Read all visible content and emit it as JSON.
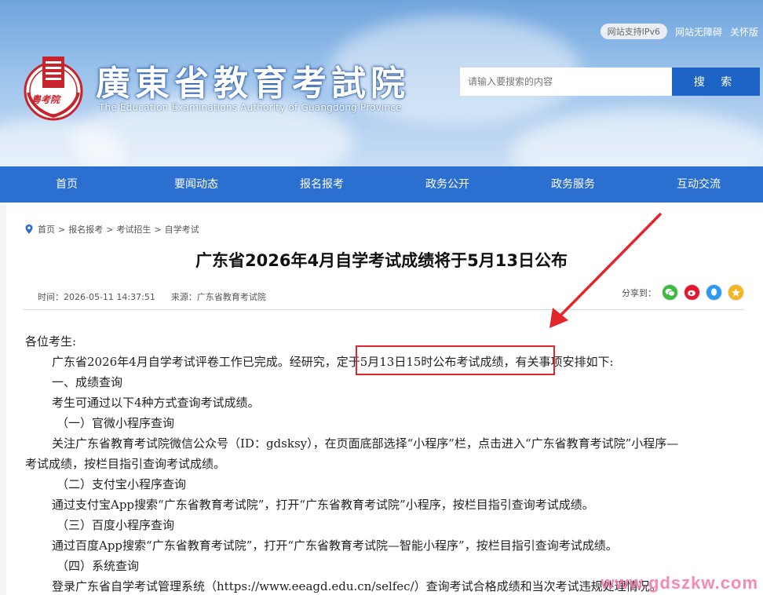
{
  "header": {
    "ipv6_badge": "网站支持IPv6",
    "accessibility_link": "网站无障碍",
    "care_link": "关怀版",
    "logo_title": "廣東省教育考試院",
    "logo_subtitle": "The Education Examinations Authority of Guangdong Province",
    "emblem_text": "粤考院",
    "search_placeholder": "请输入要搜索的内容",
    "search_button": "搜 索"
  },
  "nav": {
    "items": [
      "首页",
      "要闻动态",
      "报名报考",
      "政务公开",
      "政务服务",
      "互动交流"
    ]
  },
  "breadcrumb": {
    "items": [
      "首页",
      "报名报考",
      "考试招生",
      "自学考试"
    ],
    "separator": ">"
  },
  "article": {
    "title": "广东省2026年4月自学考试成绩将于5月13日公布",
    "time": "时间：2026-05-11 14:37:51",
    "source": "来源：广东省教育考试院",
    "share_label": "分享到：",
    "share_icons": [
      "wechat-icon",
      "weibo-icon",
      "qq-icon",
      "qzone-icon"
    ],
    "paragraphs": [
      "各位考生:",
      "广东省2026年4月自学考试评卷工作已完成。经研究，定于5月13日15时公布考试成绩，有关事项安排如下:",
      "一、成绩查询",
      "考生可通过以下4种方式查询考试成绩。",
      "（一）官微小程序查询",
      "关注广东省教育考试院微信公众号（ID：gdsksy），在页面底部选择“小程序”栏，点击进入“广东省教育考试院”小程序—",
      "考试成绩，按栏目指引查询考试成绩。",
      "（二）支付宝小程序查询",
      "通过支付宝App搜索“广东省教育考试院”，打开“广东省教育考试院”小程序，按栏目指引查询考试成绩。",
      "（三）百度小程序查询",
      "通过百度App搜索“广东省教育考试院”，打开“广东省教育考试院—智能小程序”，按栏目指引查询考试成绩。",
      "（四）系统查询",
      "登录广东省自学考试管理系统（https://www.eeagd.edu.cn/selfec/）查询考试合格成绩和当次考试违规处理情况。"
    ]
  },
  "watermark": "www.gdszkw.com",
  "colors": {
    "nav_blue": "#2b6fd0",
    "search_blue": "#1e63c6",
    "highlight_red": "#e3262b",
    "emblem_red": "#c8242b"
  }
}
